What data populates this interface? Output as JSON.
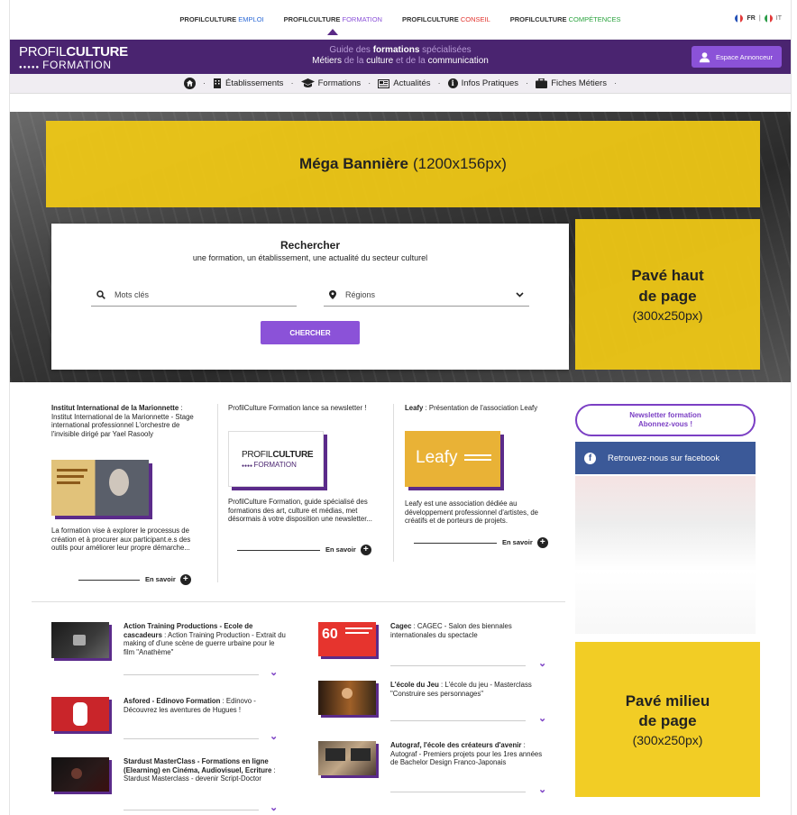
{
  "topbar": {
    "sites": [
      {
        "prefix": "PROFILCULTURE",
        "suffix": "EMPLOI",
        "color": "#2c6ad6"
      },
      {
        "prefix": "PROFILCULTURE",
        "suffix": "FORMATION",
        "color": "#8b52d8"
      },
      {
        "prefix": "PROFILCULTURE",
        "suffix": "CONSEIL",
        "color": "#e2342e"
      },
      {
        "prefix": "PROFILCULTURE",
        "suffix": "COMPÉTENCES",
        "color": "#2aa33e"
      }
    ],
    "lang_fr": "FR",
    "lang_it": "IT",
    "lang_sep": "|"
  },
  "header": {
    "logo_light": "PROFIL",
    "logo_bold": "CULTURE",
    "logo_line2": "FORMATION",
    "logo_dots": "●●●●●",
    "tagline_l1a": "Guide des ",
    "tagline_l1b": "formations",
    "tagline_l1c": " spécialisées",
    "tagline_l2a": "Métiers",
    "tagline_l2b": " de la ",
    "tagline_l2c": "culture",
    "tagline_l2d": " et de la ",
    "tagline_l2e": "communication",
    "annonceur_button": "Espace Annonceur"
  },
  "nav": {
    "items": [
      "Établissements",
      "Formations",
      "Actualités",
      "Infos Pratiques",
      "Fiches Métiers"
    ],
    "sep": "·"
  },
  "banner": {
    "title": "Méga Bannière",
    "size": "(1200x156px)"
  },
  "pave_haut": {
    "line1": "Pavé haut",
    "line2": "de page",
    "size": "(300x250px)"
  },
  "pave_milieu": {
    "line1": "Pavé milieu",
    "line2": "de page",
    "size": "(300x250px)"
  },
  "search": {
    "title": "Rechercher",
    "subtitle": "une formation, un établissement, une actualité du secteur culturel",
    "keywords_placeholder": "Mots clés",
    "regions_label": "Régions",
    "button": "CHERCHER"
  },
  "cards": [
    {
      "title_bold": "Institut International de la Marionnette",
      "title_rest": " : Institut International de la Marionnette - Stage international professionnel L'orchestre de l'invisible dirigé par Yael Rasooly",
      "body": "La formation vise à explorer le processus de création et à procurer aux participant.e.s des outils pour améliorer leur propre démarche...",
      "more": "En savoir"
    },
    {
      "title_bold": "",
      "title_rest": "ProfilCulture Formation lance sa newsletter !",
      "thumb_l1a": "PROFIL",
      "thumb_l1b": "CULTURE",
      "thumb_l2": "FORMATION",
      "body": "ProfilCulture Formation, guide spécialisé des formations des art, culture et médias, met désormais à votre disposition une newsletter...",
      "more": "En savoir"
    },
    {
      "title_bold": "Leafy",
      "title_rest": " : Présentation de l'association Leafy",
      "thumb_text": "Leafy",
      "body": "Leafy est une association dédiée au développement professionnel d'artistes, de créatifs et de porteurs de projets.",
      "more": "En savoir"
    }
  ],
  "sidebar": {
    "newsletter_l1": "Newsletter formation",
    "newsletter_l2": "Abonnez-vous !",
    "facebook": "Retrouvez-nous sur facebook"
  },
  "articles_left": [
    {
      "bold": "Action Training Productions - Ecole de cascadeurs",
      "rest": " : Action Training Production - Extrait du making of d'une scène de guerre urbaine pour le film \"Anathème\""
    },
    {
      "bold": "Asfored - Edinovo Formation",
      "rest": " : Edinovo - Découvrez les aventures de Hugues !"
    },
    {
      "bold": "Stardust MasterClass - Formations en ligne (Elearning) en Cinéma, Audiovisuel, Ecriture",
      "rest": " : Stardust Masterclass - devenir Script-Doctor"
    }
  ],
  "articles_right": [
    {
      "bold": "Cagec",
      "rest": " : CAGEC - Salon des biennales internationales du spectacle"
    },
    {
      "bold": "L'école du Jeu",
      "rest": " : L'école du jeu - Masterclass \"Construire ses personnages\""
    },
    {
      "bold": "Autograf, l'école des créateurs d'avenir",
      "rest": " : Autograf - Premiers projets pour les 1res années de Bachelor Design Franco-Japonais"
    }
  ],
  "colors": {
    "brand_purple": "#4a2470",
    "accent_purple": "#8b52d8",
    "ad_yellow": "#f1c914",
    "facebook_blue": "#3b5998"
  }
}
